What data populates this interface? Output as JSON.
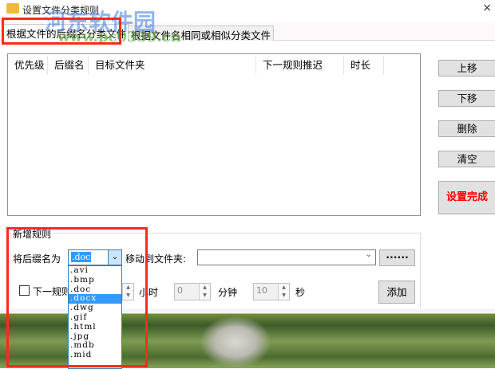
{
  "window": {
    "title": "设置文件分类规则",
    "close": "×"
  },
  "tabs": [
    {
      "label": "根据文件的后缀名分类文件",
      "selected": true
    },
    {
      "label": "根据文件名相同或相似分类文件",
      "selected": false
    }
  ],
  "table": {
    "columns": [
      "优先级",
      "后缀名",
      "目标文件夹",
      "下一规则推迟",
      "时长"
    ],
    "rows": []
  },
  "side_buttons": {
    "up": "上移",
    "down": "下移",
    "delete": "删除",
    "clear": "清空",
    "done": "设置完成"
  },
  "new_rule": {
    "group_label": "新增规则",
    "suffix_label": "将后缀名为",
    "suffix_value": ".doc",
    "suffix_options": [
      ".avi",
      ".bmp",
      ".doc",
      ".docx",
      ".dwg",
      ".gif",
      ".html",
      ".jpg",
      ".mdb",
      ".mid"
    ],
    "highlighted_option": ".docx",
    "move_label": "移动到文件夹:",
    "folder_value": "",
    "browse_label": "······",
    "delay_checkbox_label": "下一规则推迟",
    "delay_checked": false,
    "hours_value": "",
    "hours_label": "小时",
    "minutes_value": "0",
    "minutes_label": "分钟",
    "seconds_value": "10",
    "seconds_label": "秒",
    "add_label": "添加"
  },
  "watermark": {
    "name": "河东软件园",
    "url": "www.pc0359.cn"
  },
  "colors": {
    "highlight": "#3399ff",
    "done_text": "#ff0000",
    "annotation": "#ff2a1a"
  }
}
